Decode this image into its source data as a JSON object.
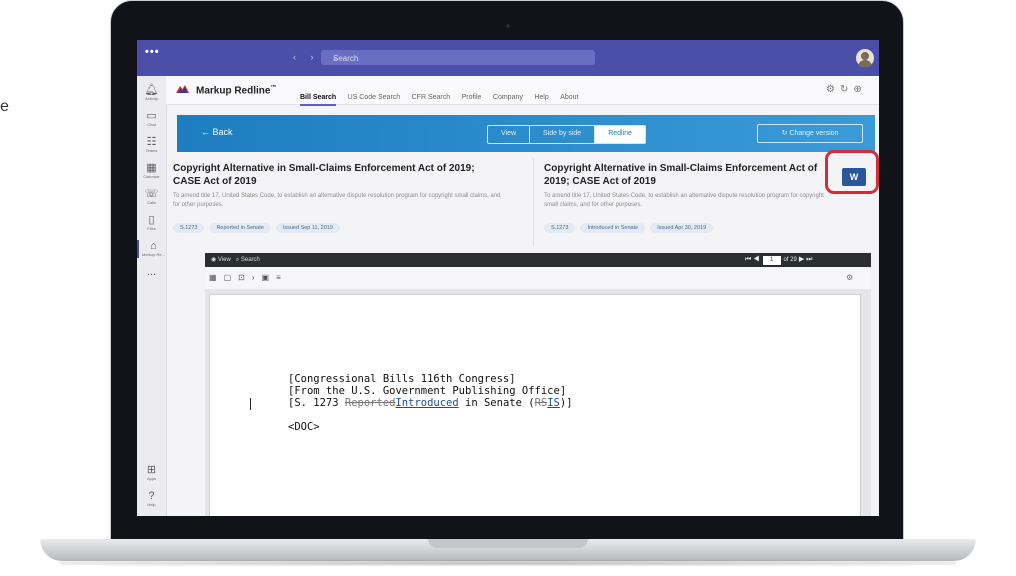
{
  "stray_text": "e",
  "teams": {
    "window_dots": "•••",
    "nav_arrows": "‹ ›",
    "search_placeholder": "Search",
    "rail": [
      {
        "label": "Activity",
        "icon": "bell-icon"
      },
      {
        "label": "Chat",
        "icon": "chat-icon"
      },
      {
        "label": "Teams",
        "icon": "teams-icon"
      },
      {
        "label": "Calendar",
        "icon": "calendar-icon"
      },
      {
        "label": "Calls",
        "icon": "phone-icon"
      },
      {
        "label": "Files",
        "icon": "file-icon"
      },
      {
        "label": "Markup Re...",
        "icon": "app-icon"
      },
      {
        "label": "...",
        "icon": "more-icon"
      },
      {
        "label": "Apps",
        "icon": "apps-icon"
      },
      {
        "label": "Help",
        "icon": "help-icon"
      }
    ]
  },
  "app": {
    "name": "Markup Redline",
    "trademark": "™",
    "tabs": [
      "Bill Search",
      "US Code Search",
      "CFR Search",
      "Profile",
      "Company",
      "Help",
      "About"
    ],
    "active_tab": "Bill Search"
  },
  "banner": {
    "back": "← Back",
    "segments": [
      "View",
      "Side by side",
      "Redline"
    ],
    "active_segment": "Redline",
    "change_version": "Change version"
  },
  "left_bill": {
    "title": "Copyright Alternative in Small-Claims Enforcement Act of 2019; CASE Act of 2019",
    "desc": "To amend title 17, United States Code, to establish an alternative dispute resolution program for copyright small claims, and for other purposes.",
    "chips": [
      "S.1273",
      "Reported in Senate",
      "Issued Sep 11, 2019"
    ]
  },
  "right_bill": {
    "title": "Copyright Alternative in Small-Claims Enforcement Act of 2019; CASE Act of 2019",
    "desc": "To amend title 17, United States Code, to establish an alternative dispute resolution program for copyright small claims, and for other purposes.",
    "chips": [
      "S.1273",
      "Introduced in Senate",
      "Issued Apr 30, 2019"
    ]
  },
  "word_icon": "W",
  "viewer": {
    "view_label": "View",
    "search_label": "Search",
    "page_current": "1",
    "page_total": "of 29"
  },
  "document": {
    "line1": "[Congressional Bills 116th Congress]",
    "line2": "[From the U.S. Government Publishing Office]",
    "line3_prefix": "[S. 1273 ",
    "line3_deleted": "Reported",
    "line3_inserted": "Introduced",
    "line3_middle": " in Senate (",
    "line3_rs": "RS",
    "line3_is": "IS",
    "line3_suffix": ")]",
    "line4": "<DOC>"
  },
  "colors": {
    "teams_purple": "#4b4fa8",
    "banner_blue": "#1e7dc0",
    "highlight_red": "#d42d3a",
    "word_blue": "#2b579a"
  }
}
